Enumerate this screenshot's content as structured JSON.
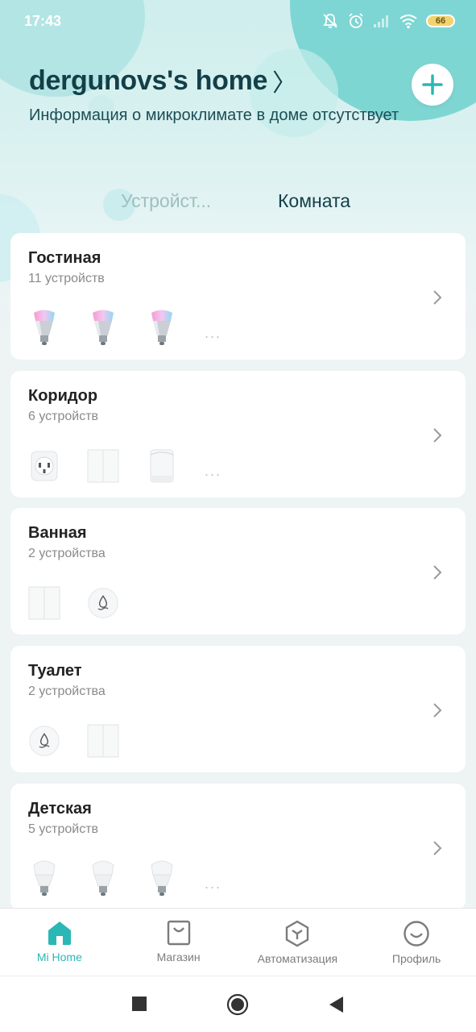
{
  "status_bar": {
    "time": "17:43",
    "battery": "66"
  },
  "header": {
    "home_name": "dergunovs's home",
    "chevron": "〉",
    "microclimate": "Информация о микроклимате в доме отсутствует"
  },
  "tabs": {
    "devices": "Устройст...",
    "room": "Комната"
  },
  "rooms": [
    {
      "name": "Гостиная",
      "count": "11 устройств",
      "devices": [
        "color-bulb",
        "color-bulb",
        "color-bulb"
      ],
      "more": "..."
    },
    {
      "name": "Коридор",
      "count": "6 устройств",
      "devices": [
        "smart-plug",
        "wall-switch",
        "motion-sensor"
      ],
      "more": "..."
    },
    {
      "name": "Ванная",
      "count": "2 устройства",
      "devices": [
        "wall-switch",
        "water-leak-sensor"
      ],
      "more": ""
    },
    {
      "name": "Туалет",
      "count": "2 устройства",
      "devices": [
        "water-leak-sensor",
        "wall-switch"
      ],
      "more": ""
    },
    {
      "name": "Детская",
      "count": "5 устройств",
      "devices": [
        "white-bulb",
        "white-bulb",
        "white-bulb"
      ],
      "more": "..."
    }
  ],
  "bottom_nav": [
    {
      "label": "Mi Home",
      "icon": "home-icon",
      "active": true
    },
    {
      "label": "Магазин",
      "icon": "store-icon",
      "active": false
    },
    {
      "label": "Автоматизация",
      "icon": "automation-icon",
      "active": false
    },
    {
      "label": "Профиль",
      "icon": "profile-icon",
      "active": false
    }
  ],
  "colors": {
    "accent": "#2bb7b5",
    "title": "#133f48"
  }
}
